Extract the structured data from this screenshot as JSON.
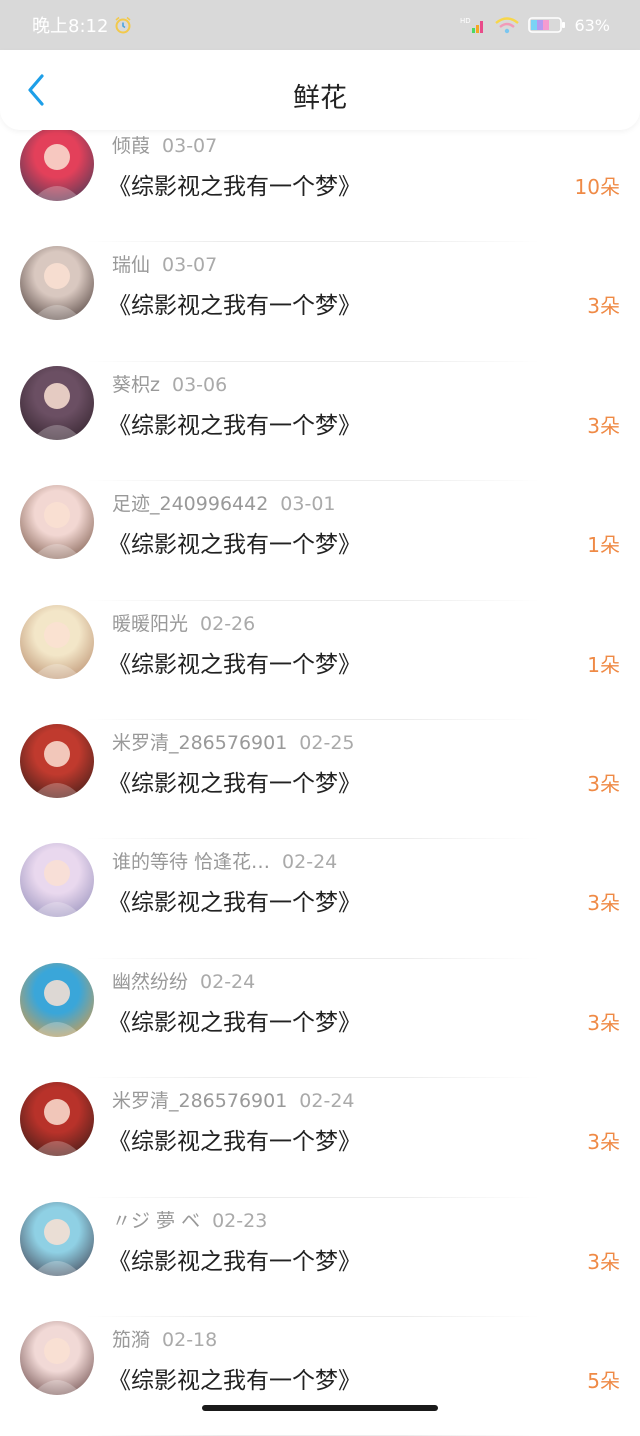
{
  "status_bar": {
    "time": "晚上8:12",
    "battery": "63%",
    "icons": [
      "alarm-icon",
      "signal-icon",
      "wifi-icon",
      "battery-icon"
    ]
  },
  "header": {
    "title": "鲜花",
    "back_icon": "chevron-left-icon"
  },
  "colors": {
    "accent_blue": "#1e9fe8",
    "count_orange": "#ef8a46",
    "status_bar_bg": "#d9d9d9"
  },
  "items": [
    {
      "name": "倾葭",
      "date": "03-07",
      "book": "《综影视之我有一个梦》",
      "count": "10朵",
      "avatar_colors": [
        "#e3405a",
        "#2f3a56"
      ]
    },
    {
      "name": "瑞仙",
      "date": "03-07",
      "book": "《综影视之我有一个梦》",
      "count": "3朵",
      "avatar_colors": [
        "#d9c8c0",
        "#3a2b28"
      ]
    },
    {
      "name": "葵枳z",
      "date": "03-06",
      "book": "《综影视之我有一个梦》",
      "count": "3朵",
      "avatar_colors": [
        "#6b4f63",
        "#2a1c24"
      ]
    },
    {
      "name": "足迹_240996442",
      "date": "03-01",
      "book": "《综影视之我有一个梦》",
      "count": "1朵",
      "avatar_colors": [
        "#f2d7d2",
        "#6a4838"
      ]
    },
    {
      "name": "暖暖阳光",
      "date": "02-26",
      "book": "《综影视之我有一个梦》",
      "count": "1朵",
      "avatar_colors": [
        "#f3e6c8",
        "#b08060"
      ]
    },
    {
      "name": "米罗清_286576901",
      "date": "02-25",
      "book": "《综影视之我有一个梦》",
      "count": "3朵",
      "avatar_colors": [
        "#c03a2e",
        "#2b1a16"
      ]
    },
    {
      "name": "谁的等待 恰逢花…",
      "date": "02-24",
      "book": "《综影视之我有一个梦》",
      "count": "3朵",
      "avatar_colors": [
        "#e9d8ee",
        "#8a86b4"
      ]
    },
    {
      "name": "幽然纷纷",
      "date": "02-24",
      "book": "《综影视之我有一个梦》",
      "count": "3朵",
      "avatar_colors": [
        "#3aa6d9",
        "#f29a2e"
      ]
    },
    {
      "name": "米罗清_286576901",
      "date": "02-24",
      "book": "《综影视之我有一个梦》",
      "count": "3朵",
      "avatar_colors": [
        "#b8322a",
        "#2b1a16"
      ]
    },
    {
      "name": "〃ジ 夢 ベ",
      "date": "02-23",
      "book": "《综影视之我有一个梦》",
      "count": "3朵",
      "avatar_colors": [
        "#8fd0e4",
        "#3a3140"
      ]
    },
    {
      "name": "笳漪",
      "date": "02-18",
      "book": "《综影视之我有一个梦》",
      "count": "5朵",
      "avatar_colors": [
        "#f1d9d6",
        "#5b3a3a"
      ]
    }
  ]
}
